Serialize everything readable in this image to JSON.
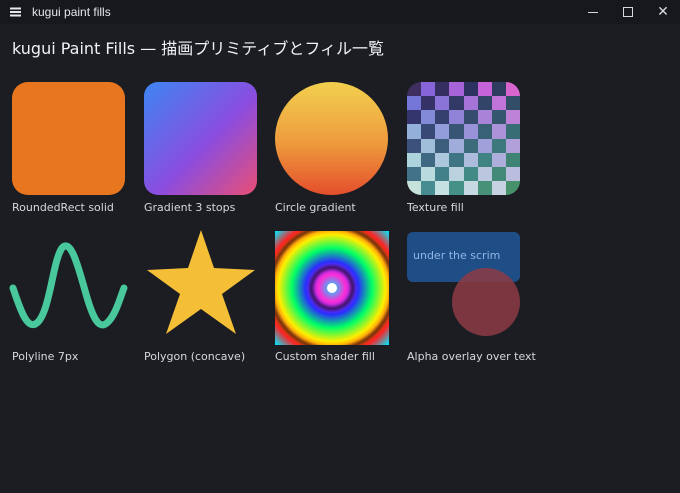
{
  "window": {
    "title": "kugui paint fills",
    "controls": [
      "minimize",
      "maximize",
      "close"
    ]
  },
  "page": {
    "title": "kugui Paint Fills — 描画プリミティブとフィル一覧"
  },
  "tiles": [
    {
      "caption": "RoundedRect solid",
      "fill": "#e8761f"
    },
    {
      "caption": "Gradient 3 stops",
      "stops": [
        "#3d86f2",
        "#8b4de0",
        "#e84e74"
      ]
    },
    {
      "caption": "Circle gradient",
      "stops": [
        "#f2d04e",
        "#ee9a3c",
        "#e44e2c"
      ]
    },
    {
      "caption": "Texture fill"
    },
    {
      "caption": "Polyline 7px",
      "stroke": "#49c99b"
    },
    {
      "caption": "Polygon (concave)",
      "fill": "#f4bf37"
    },
    {
      "caption": "Custom shader fill"
    },
    {
      "caption": "Alpha overlay over text",
      "overlay_text": "under the scrim",
      "rect_color": "#1f4e87",
      "circle_color": "#8d3b44"
    }
  ]
}
